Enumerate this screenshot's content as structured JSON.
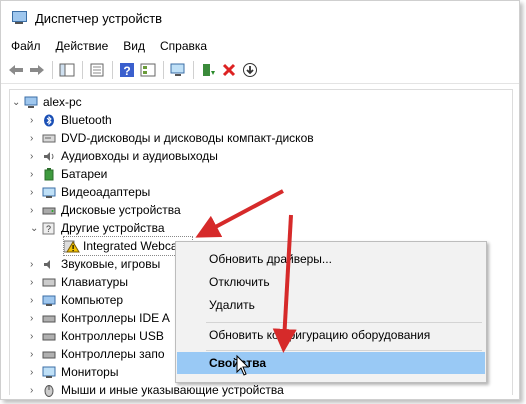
{
  "window": {
    "title": "Диспетчер устройств"
  },
  "menu": [
    "Файл",
    "Действие",
    "Вид",
    "Справка"
  ],
  "tree": {
    "root": "alex-pc",
    "items": [
      "Bluetooth",
      "DVD-дисководы и дисководы компакт-дисков",
      "Аудиовходы и аудиовыходы",
      "Батареи",
      "Видеоадаптеры",
      "Дисковые устройства",
      "Другие устройства",
      "Integrated Webcam",
      "Звуковые, игровы",
      "Клавиатуры",
      "Компьютер",
      "Контроллеры IDE A",
      "Контроллеры USB",
      "Контроллеры запо",
      "Мониторы",
      "Мыши и иные указывающие устройства"
    ]
  },
  "context_menu": {
    "items": [
      "Обновить драйверы...",
      "Отключить",
      "Удалить",
      "Обновить конфигурацию оборудования",
      "Свойства"
    ]
  },
  "colors": {
    "highlight": "#99c9f5",
    "arrow": "#d62a2a"
  }
}
